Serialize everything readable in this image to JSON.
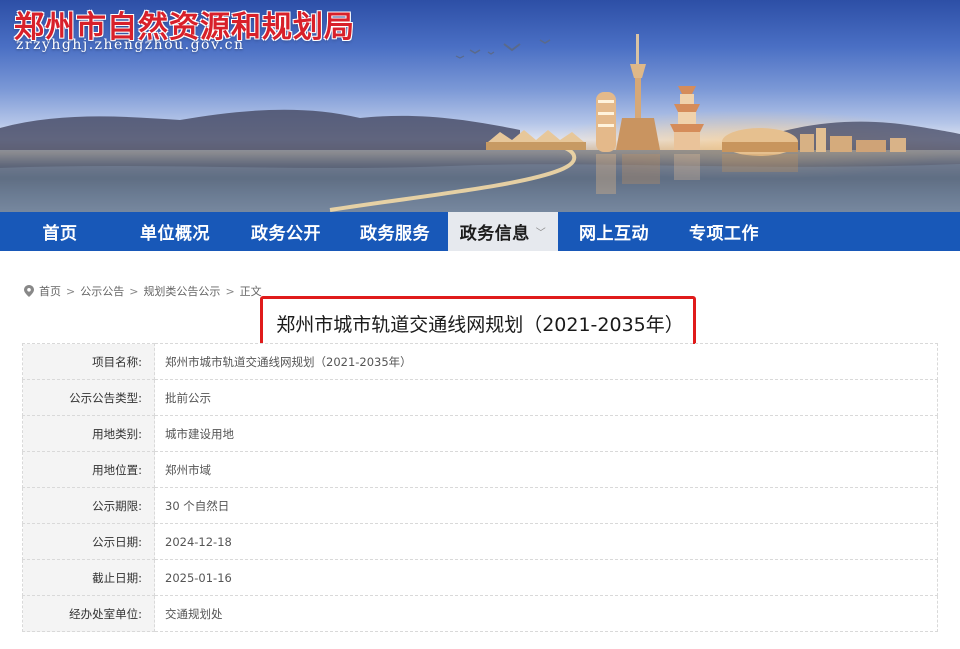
{
  "site": {
    "title": "郑州市自然资源和规划局",
    "url": "zrzyhghj.zhengzhou.gov.cn"
  },
  "colors": {
    "nav_bg": "#1858b8",
    "nav_active_bg": "#e6e9ee",
    "title_red": "#d8202a",
    "highlight_red": "#e01b1b"
  },
  "nav": {
    "items": [
      {
        "label": "首页",
        "active": false
      },
      {
        "label": "单位概况",
        "active": false
      },
      {
        "label": "政务公开",
        "active": false
      },
      {
        "label": "政务服务",
        "active": false
      },
      {
        "label": "政务信息",
        "active": true,
        "icon": "chevron-down-icon"
      },
      {
        "label": "网上互动",
        "active": false
      },
      {
        "label": "专项工作",
        "active": false
      }
    ]
  },
  "breadcrumb": {
    "icon": "location-pin-icon",
    "items": [
      "首页",
      "公示公告",
      "规划类公告公示",
      "正文"
    ],
    "separator": ">"
  },
  "article": {
    "title": "郑州市城市轨道交通线网规划（2021-2035年）"
  },
  "details": {
    "rows": [
      {
        "label": "项目名称:",
        "value": "郑州市城市轨道交通线网规划（2021-2035年）"
      },
      {
        "label": "公示公告类型:",
        "value": "批前公示"
      },
      {
        "label": "用地类别:",
        "value": "城市建设用地"
      },
      {
        "label": "用地位置:",
        "value": "郑州市域"
      },
      {
        "label": "公示期限:",
        "value": "30 个自然日"
      },
      {
        "label": "公示日期:",
        "value": "2024-12-18"
      },
      {
        "label": "截止日期:",
        "value": "2025-01-16"
      },
      {
        "label": "经办处室单位:",
        "value": "交通规划处"
      }
    ]
  }
}
